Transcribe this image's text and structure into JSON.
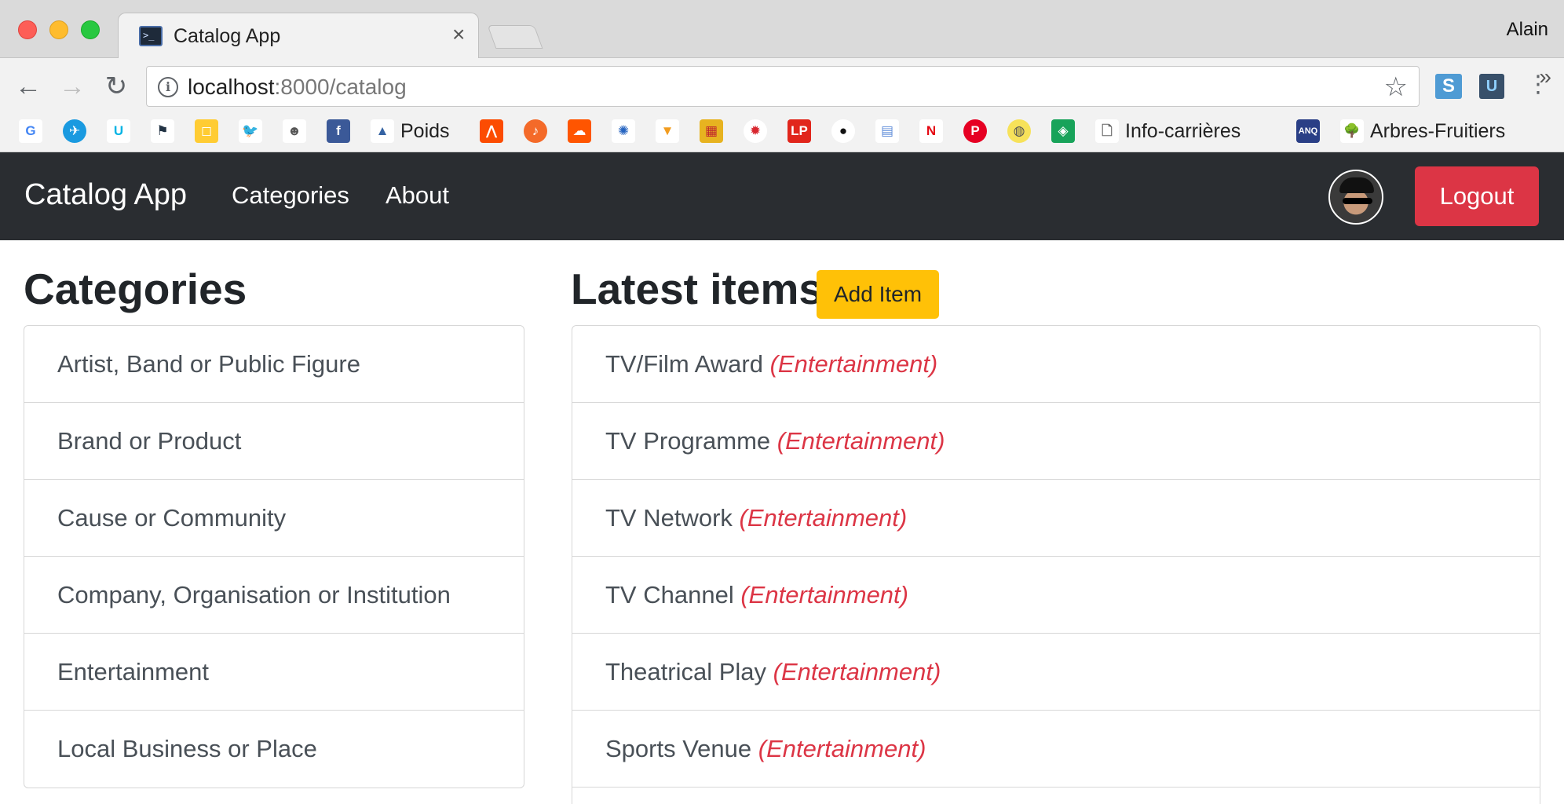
{
  "browser": {
    "tab_title": "Catalog App",
    "tab_close": "×",
    "profile_name": "Alain",
    "url_host": "localhost",
    "url_rest": ":8000/catalog",
    "bookmarks": [
      {
        "icon": "google-icon",
        "glyph": "G",
        "color": "#ffffff",
        "fg": "#4285f4",
        "label": ""
      },
      {
        "icon": "plane-icon",
        "glyph": "✈",
        "color": "#1a9ae0",
        "fg": "#ffffff",
        "label": ""
      },
      {
        "icon": "udacity-icon",
        "glyph": "U",
        "color": "#ffffff",
        "fg": "#02b3e4",
        "label": ""
      },
      {
        "icon": "lighthouse-icon",
        "glyph": "⚑",
        "color": "#ffffff",
        "fg": "#234",
        "label": ""
      },
      {
        "icon": "square-icon",
        "glyph": "◻",
        "color": "#ffcc33",
        "fg": "#ffffff",
        "label": ""
      },
      {
        "icon": "twitter-icon",
        "glyph": "🐦",
        "color": "#ffffff",
        "fg": "#1da1f2",
        "label": ""
      },
      {
        "icon": "reddit-icon",
        "glyph": "☻",
        "color": "#ffffff",
        "fg": "#555",
        "label": ""
      },
      {
        "icon": "facebook-icon",
        "glyph": "f",
        "color": "#3b5998",
        "fg": "#ffffff",
        "label": ""
      },
      {
        "icon": "triangle-icon",
        "glyph": "▲",
        "color": "#ffffff",
        "fg": "#3563a3",
        "label": "Poids"
      },
      {
        "icon": "strava-icon",
        "glyph": "⋀",
        "color": "#fc4c02",
        "fg": "#ffffff",
        "label": ""
      },
      {
        "icon": "music-icon",
        "glyph": "♪",
        "color": "#f46a29",
        "fg": "#ffffff",
        "label": ""
      },
      {
        "icon": "soundcloud-icon",
        "glyph": "☁",
        "color": "#ff5500",
        "fg": "#ffffff",
        "label": ""
      },
      {
        "icon": "globe-icon",
        "glyph": "✺",
        "color": "#ffffff",
        "fg": "#2463c0",
        "label": ""
      },
      {
        "icon": "wedge-icon",
        "glyph": "▼",
        "color": "#ffffff",
        "fg": "#f29c1f",
        "label": ""
      },
      {
        "icon": "calendar-icon",
        "glyph": "▦",
        "color": "#e7b320",
        "fg": "#c0262d",
        "label": ""
      },
      {
        "icon": "radio-canada-icon",
        "glyph": "✹",
        "color": "#ffffff",
        "fg": "#d8262e",
        "label": ""
      },
      {
        "icon": "lp-icon",
        "glyph": "LP",
        "color": "#e1261c",
        "fg": "#ffffff",
        "label": ""
      },
      {
        "icon": "github-icon",
        "glyph": "●",
        "color": "#ffffff",
        "fg": "#111111",
        "label": ""
      },
      {
        "icon": "calendar-g-icon",
        "glyph": "▤",
        "color": "#ffffff",
        "fg": "#5b8ad8",
        "label": ""
      },
      {
        "icon": "netflix-icon",
        "glyph": "N",
        "color": "#ffffff",
        "fg": "#e50914",
        "label": ""
      },
      {
        "icon": "pinterest-icon",
        "glyph": "P",
        "color": "#e60023",
        "fg": "#ffffff",
        "label": ""
      },
      {
        "icon": "ball-icon",
        "glyph": "◍",
        "color": "#f7e25a",
        "fg": "#555",
        "label": ""
      },
      {
        "icon": "green-square-icon",
        "glyph": "◈",
        "color": "#18a35a",
        "fg": "#ffffff",
        "label": ""
      },
      {
        "icon": "page-icon",
        "glyph": "🗋",
        "color": "#ffffff",
        "fg": "#666",
        "label": "Info-carrières"
      },
      {
        "icon": "anq-icon",
        "glyph": "ANQ",
        "color": "#2a3f86",
        "fg": "#ffffff",
        "label": ""
      },
      {
        "icon": "tree-icon",
        "glyph": "🌳",
        "color": "#ffffff",
        "fg": "#6a7a2a",
        "label": "Arbres-Fruitiers"
      }
    ],
    "more": "»"
  },
  "navbar": {
    "brand": "Catalog App",
    "links": [
      "Categories",
      "About"
    ],
    "logout_label": "Logout"
  },
  "categories": {
    "heading": "Categories",
    "items": [
      "Artist, Band or Public Figure",
      "Brand or Product",
      "Cause or Community",
      "Company, Organisation or Institution",
      "Entertainment",
      "Local Business or Place"
    ]
  },
  "latest": {
    "heading": "Latest items",
    "add_label": "Add Item",
    "items": [
      {
        "name": "TV/Film Award",
        "category": "(Entertainment)"
      },
      {
        "name": "TV Programme",
        "category": "(Entertainment)"
      },
      {
        "name": "TV Network",
        "category": "(Entertainment)"
      },
      {
        "name": "TV Channel",
        "category": "(Entertainment)"
      },
      {
        "name": "Theatrical Play",
        "category": "(Entertainment)"
      },
      {
        "name": "Sports Venue",
        "category": "(Entertainment)"
      }
    ]
  },
  "colors": {
    "navbar_bg": "#2a2d31",
    "logout_red": "#dc3545",
    "add_yellow": "#ffc107",
    "category_red": "#dc3545"
  }
}
